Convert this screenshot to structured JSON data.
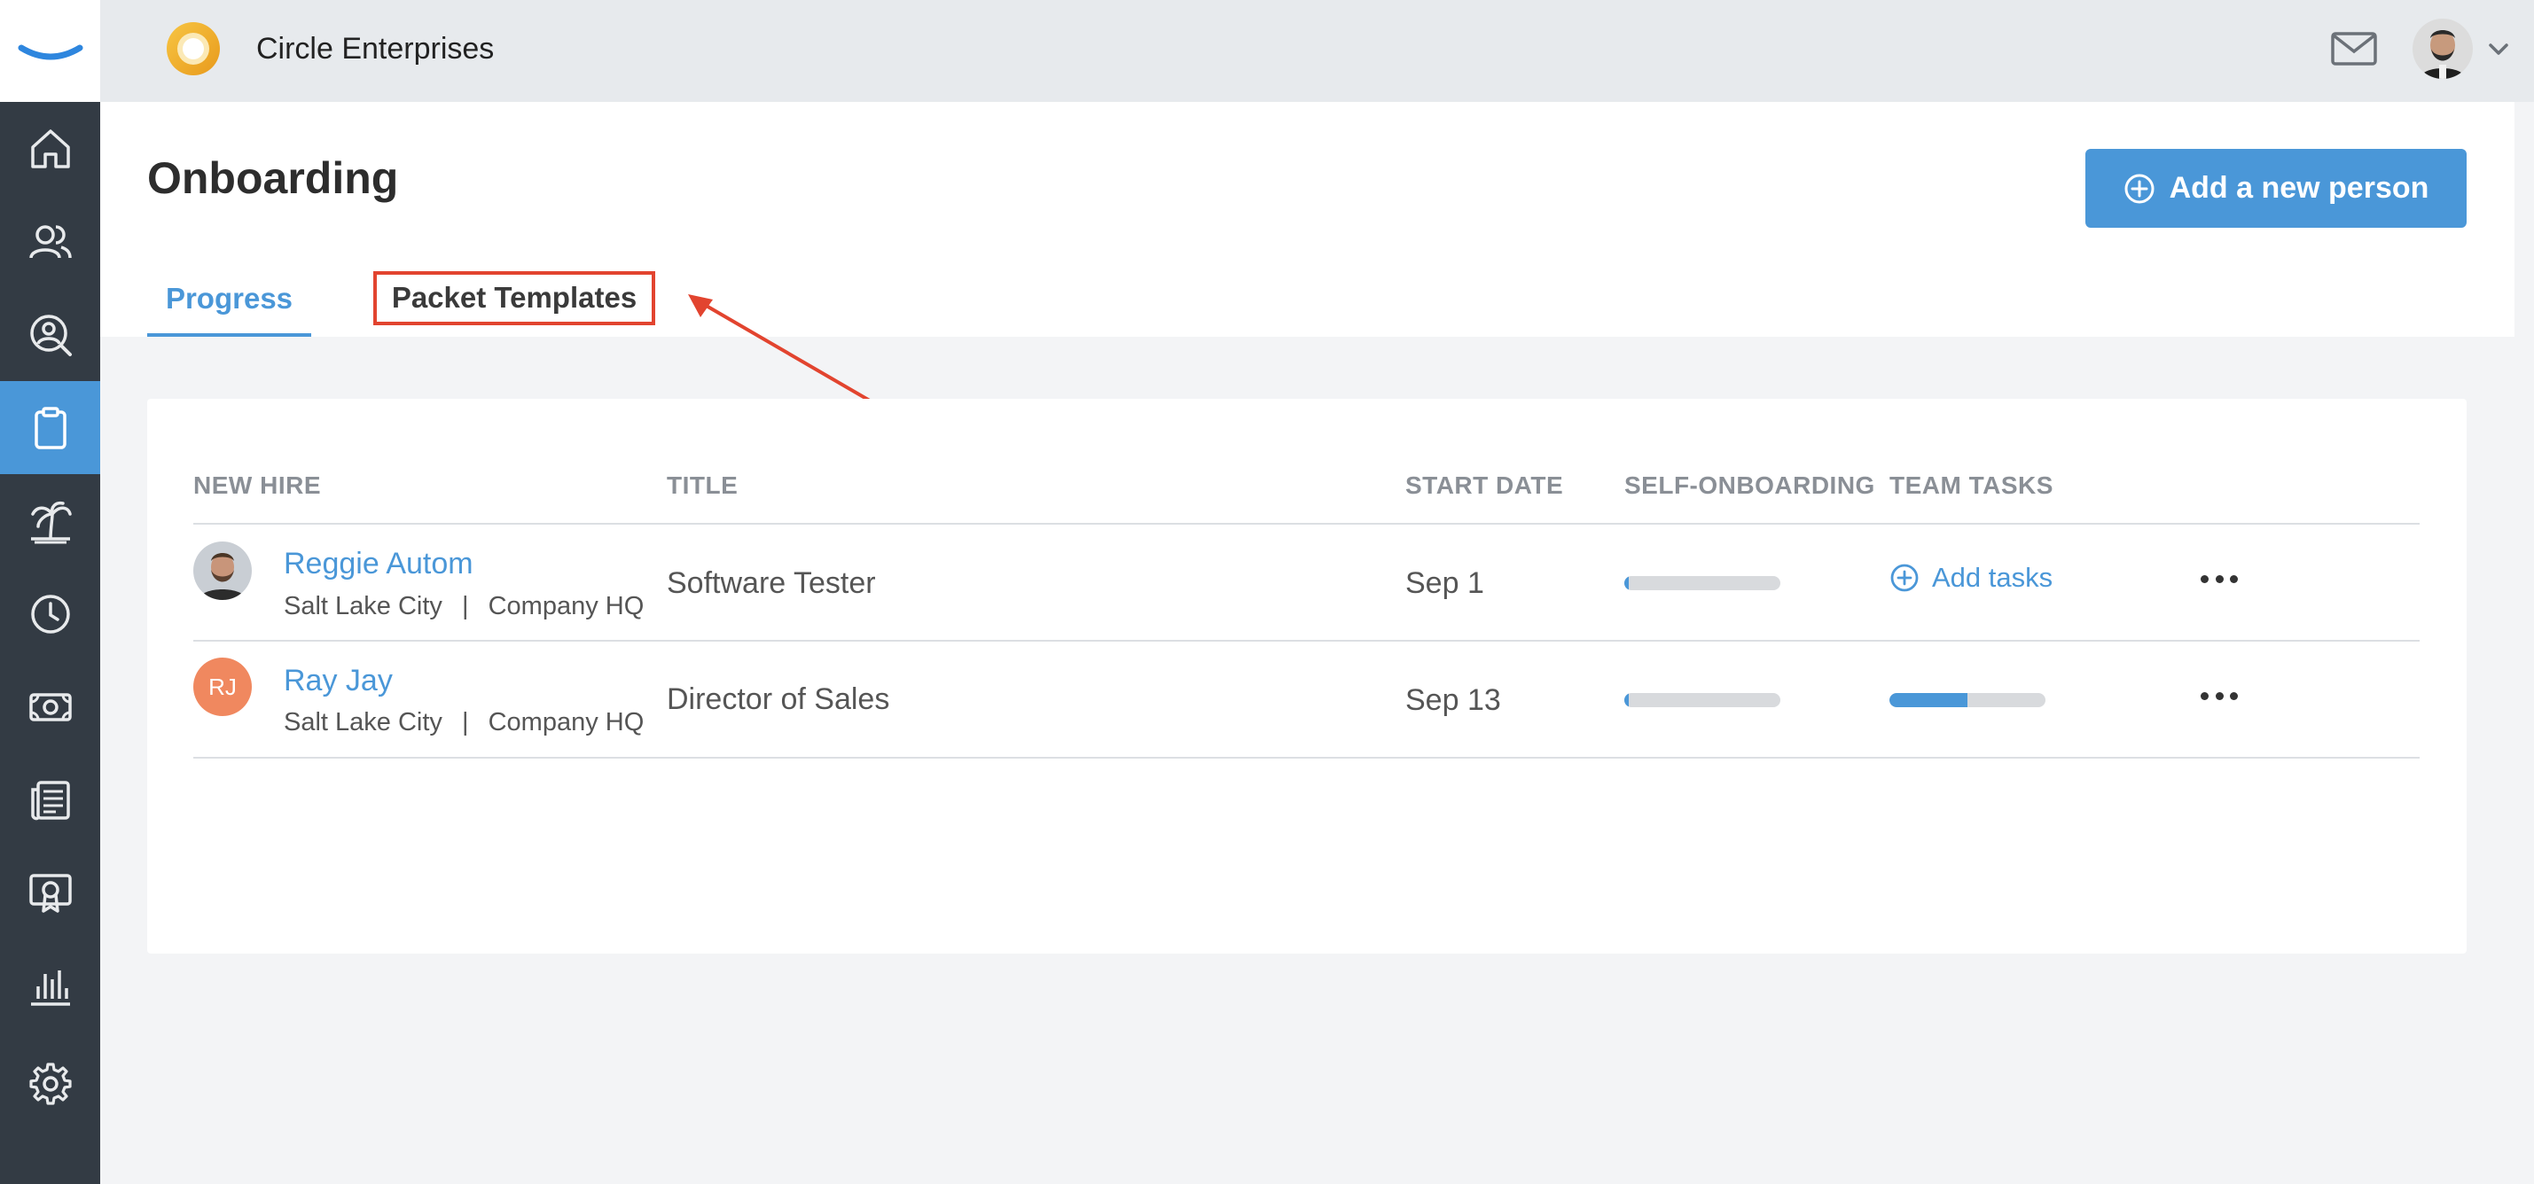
{
  "company": {
    "name": "Circle Enterprises"
  },
  "page": {
    "title": "Onboarding",
    "add_button_label": "Add a new person"
  },
  "tabs": [
    {
      "label": "Progress",
      "active": true
    },
    {
      "label": "Packet Templates",
      "highlighted": true
    }
  ],
  "table": {
    "headers": {
      "new_hire": "NEW HIRE",
      "title": "TITLE",
      "start_date": "START DATE",
      "self_onboarding": "SELF-ONBOARDING",
      "team_tasks": "TEAM TASKS"
    },
    "rows": [
      {
        "name": "Reggie Autom",
        "city": "Salt Lake City",
        "separator": "|",
        "office": "Company HQ",
        "title": "Software Tester",
        "start_date": "Sep 1",
        "self_onboarding_progress": 0.03,
        "team_tasks_action": "Add tasks"
      },
      {
        "name": "Ray Jay",
        "initials": "RJ",
        "city": "Salt Lake City",
        "separator": "|",
        "office": "Company HQ",
        "title": "Director of Sales",
        "start_date": "Sep 13",
        "self_onboarding_progress": 0.03,
        "team_tasks_progress": 0.5
      }
    ]
  },
  "colors": {
    "accent": "#4a97d8",
    "sidebar": "#333b44",
    "highlight_box": "#e2442f",
    "initials_avatar": "#f0885f"
  },
  "sidebar": {
    "items": [
      {
        "icon": "home-icon"
      },
      {
        "icon": "people-icon"
      },
      {
        "icon": "person-search-icon"
      },
      {
        "icon": "clipboard-icon",
        "active": true
      },
      {
        "icon": "palm-tree-icon"
      },
      {
        "icon": "clock-icon"
      },
      {
        "icon": "money-icon"
      },
      {
        "icon": "news-icon"
      },
      {
        "icon": "certificate-icon"
      },
      {
        "icon": "bar-chart-icon"
      },
      {
        "icon": "gear-icon"
      }
    ]
  }
}
